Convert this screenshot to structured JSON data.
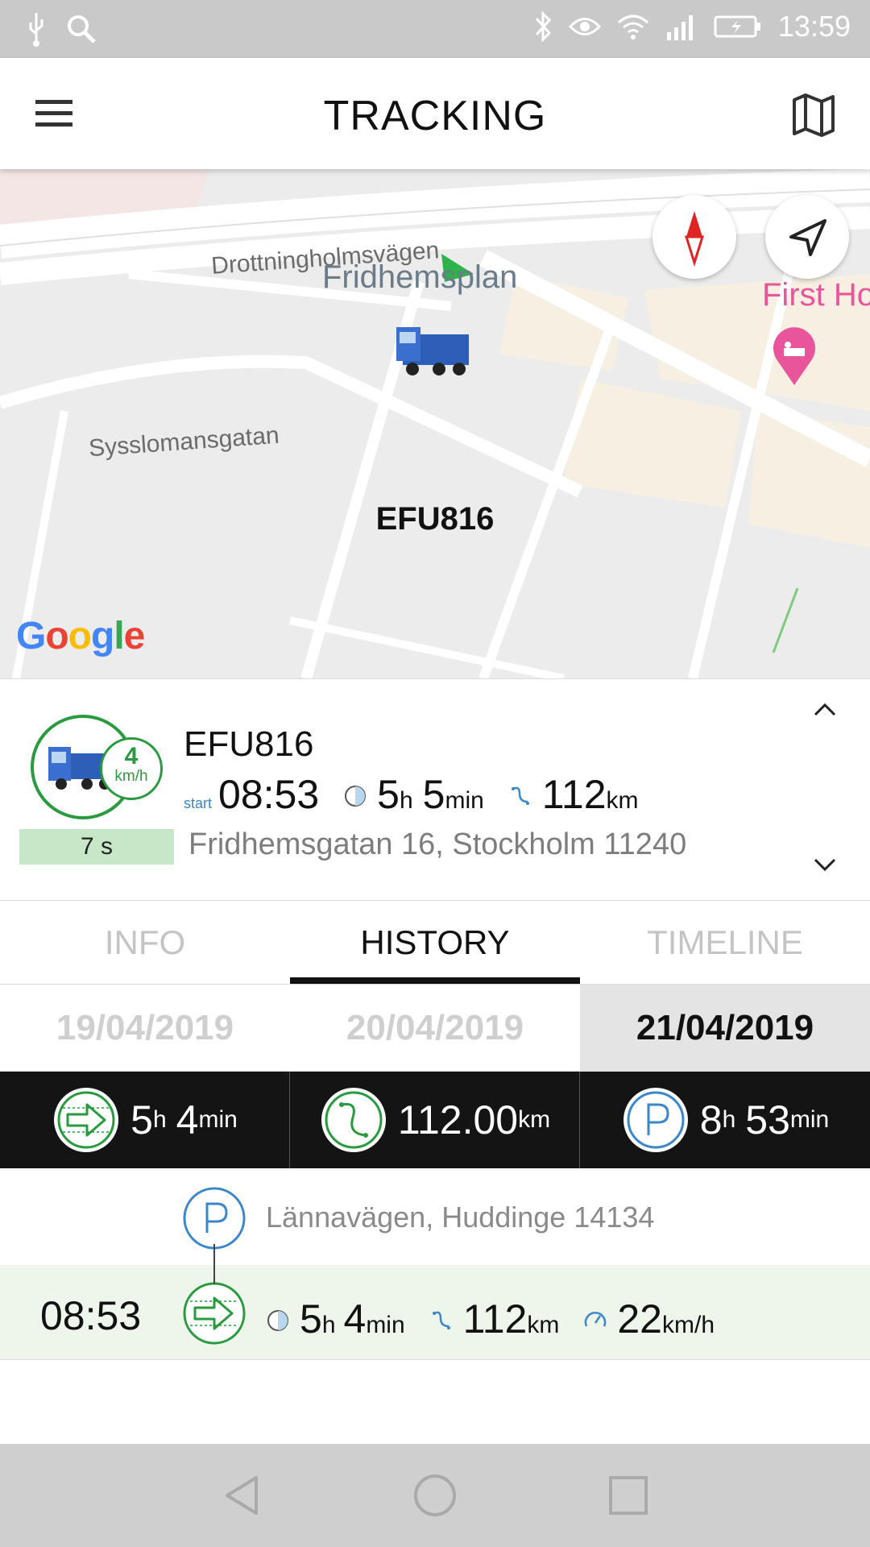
{
  "status_bar": {
    "time": "13:59",
    "left_icons": [
      "usb-icon",
      "search-icon"
    ],
    "right_icons": [
      "bluetooth-icon",
      "eye-icon",
      "wifi-icon",
      "signal-icon",
      "battery-icon"
    ]
  },
  "app_bar": {
    "title": "TRACKING",
    "menu_icon": "hamburger-menu-icon",
    "map_icon": "map-icon"
  },
  "map": {
    "labels": {
      "street1": "Drottningholmsvägen",
      "square": "Fridhemsplan",
      "street2": "Sysslomansgatan",
      "hotel": "First Ho"
    },
    "vehicle_label": "EFU816",
    "google": "Google"
  },
  "vehicle": {
    "name": "EFU816",
    "speed_value": "4",
    "speed_unit": "km/h",
    "age": "7 s",
    "start_label": "start",
    "start_time": "08:53",
    "duration_h": "5",
    "duration_h_unit": "h",
    "duration_m": "5",
    "duration_m_unit": "min",
    "distance": "112",
    "distance_unit": "km",
    "address": "Fridhemsgatan 16, Stockholm 11240"
  },
  "tabs": [
    "INFO",
    "HISTORY",
    "TIMELINE"
  ],
  "active_tab": "HISTORY",
  "dates": [
    "19/04/2019",
    "20/04/2019",
    "21/04/2019"
  ],
  "active_date": "21/04/2019",
  "summary": {
    "drive": {
      "h": "5",
      "h_unit": "h",
      "m": "4",
      "m_unit": "min"
    },
    "distance": {
      "value": "112.00",
      "unit": "km"
    },
    "parking": {
      "h": "8",
      "h_unit": "h",
      "m": "53",
      "m_unit": "min"
    }
  },
  "history": {
    "stop_address": "Lännavägen, Huddinge 14134",
    "trip": {
      "time": "08:53",
      "duration_h": "5",
      "h_unit": "h",
      "duration_m": "4",
      "m_unit": "min",
      "distance": "112",
      "distance_unit": "km",
      "speed": "22",
      "speed_unit": "km/h"
    }
  },
  "colors": {
    "accent_green": "#2a9a3f",
    "accent_blue": "#3a87c9",
    "dark_bar": "#141414"
  }
}
